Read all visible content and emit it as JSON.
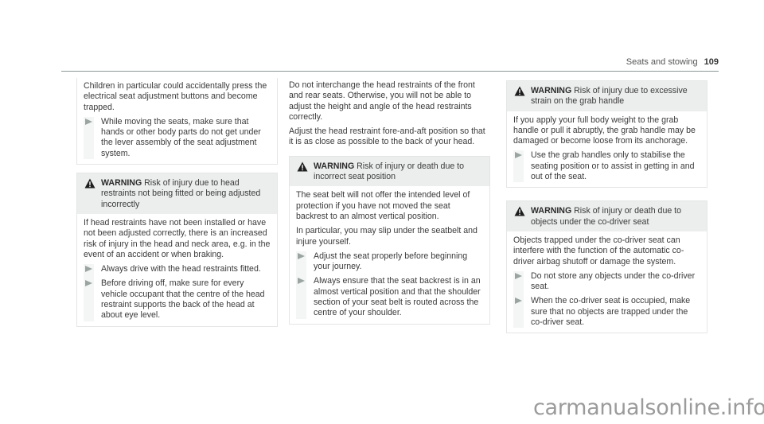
{
  "header": {
    "section_title": "Seats and stowing",
    "page_number": "109"
  },
  "warning_icon": "warning-triangle-icon",
  "step_icon": "arrow-right-icon",
  "column1": {
    "intro_box": {
      "text": "Children in particular could accidentally press the electrical seat adjustment buttons and become trapped.",
      "steps": [
        "While moving the seats, make sure that hands or other body parts do not get under the lever assembly of the seat adjustment system."
      ]
    },
    "warning_head_restraints": {
      "label": "WARNING",
      "title": "Risk of injury due to head restraints not being fitted or being adjusted incorrectly",
      "body": "If head restraints have not been installed or have not been adjusted correctly, there is an increased risk of injury in the head and neck area, e.g. in the event of an accident or when braking.",
      "steps": [
        "Always drive with the head restraints fitted.",
        "Before driving off, make sure for every vehicle occupant that the centre of the head restraint supports the back of the head at about eye level."
      ]
    }
  },
  "column2": {
    "paragraphs": [
      "Do not interchange the head restraints of the front and rear seats. Otherwise, you will not be able to adjust the height and angle of the head restraints correctly.",
      "Adjust the head restraint fore-and-aft position so that it is as close as possible to the back of your head."
    ],
    "warning_seat_position": {
      "label": "WARNING",
      "title": "Risk of injury or death due to incorrect seat position",
      "body": [
        "The seat belt will not offer the intended level of protection if you have not moved the seat backrest to an almost vertical position.",
        "In particular, you may slip under the seatbelt and injure yourself."
      ],
      "steps": [
        "Adjust the seat properly before beginning your journey.",
        "Always ensure that the seat backrest is in an almost vertical position and that the shoulder section of your seat belt is routed across the centre of your shoulder."
      ]
    }
  },
  "column3": {
    "warning_grab_handle": {
      "label": "WARNING",
      "title": "Risk of injury due to excessive strain on the grab handle",
      "body": "If you apply your full body weight to the grab handle or pull it abruptly, the grab handle may be damaged or become loose from its anchorage.",
      "steps": [
        "Use the grab handles only to stabilise the seating position or to assist in getting in and out of the seat."
      ]
    },
    "warning_codriver_seat": {
      "label": "WARNING",
      "title": "Risk of injury or death due to objects under the co-driver seat",
      "body": "Objects trapped under the co-driver seat can interfere with the function of the automatic co-driver airbag shutoff or damage the system.",
      "steps": [
        "Do not store any objects under the co-driver seat.",
        "When the co-driver seat is occupied, make sure that no objects are trapped under the co-driver seat."
      ]
    }
  },
  "watermark": "carmanualsonline.info"
}
